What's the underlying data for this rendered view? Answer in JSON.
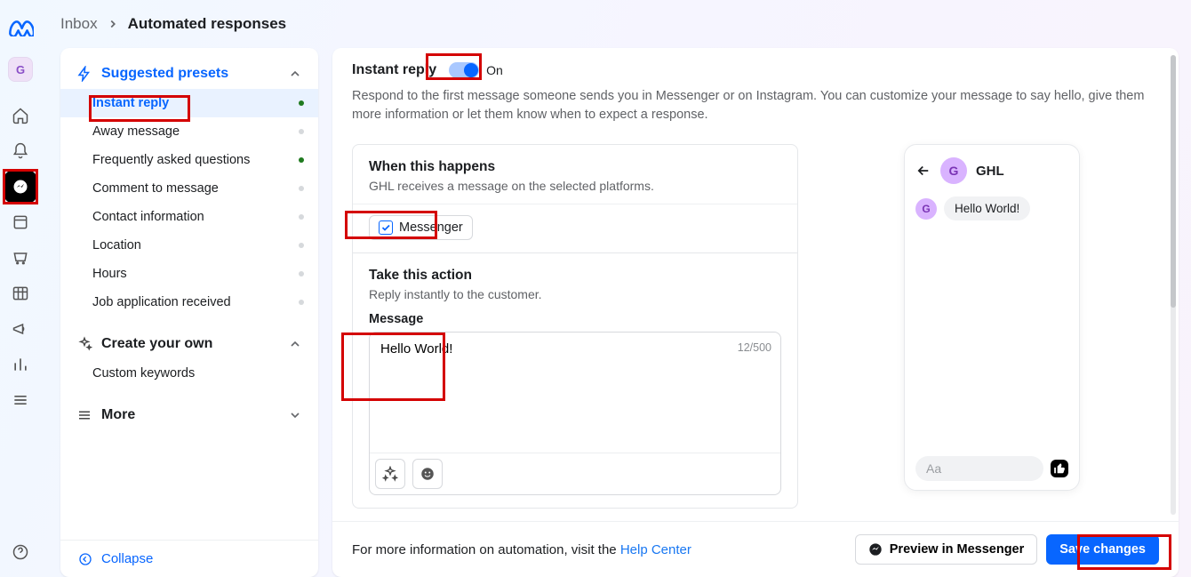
{
  "rail": {
    "avatar_initial": "G"
  },
  "breadcrumb": {
    "root": "Inbox",
    "current": "Automated responses"
  },
  "sidebar": {
    "suggested_label": "Suggested presets",
    "presets": [
      {
        "label": "Instant reply",
        "status": "green",
        "selected": true
      },
      {
        "label": "Away message",
        "status": "gray"
      },
      {
        "label": "Frequently asked questions",
        "status": "green"
      },
      {
        "label": "Comment to message",
        "status": "gray"
      },
      {
        "label": "Contact information",
        "status": "gray"
      },
      {
        "label": "Location",
        "status": "gray"
      },
      {
        "label": "Hours",
        "status": "gray"
      },
      {
        "label": "Job application received",
        "status": "gray"
      }
    ],
    "create_label": "Create your own",
    "create_items": [
      {
        "label": "Custom keywords"
      }
    ],
    "more_label": "More",
    "collapse_label": "Collapse"
  },
  "content": {
    "title": "Instant reply",
    "toggle_state": "On",
    "description": "Respond to the first message someone sends you in Messenger or on Instagram. You can customize your message to say hello, give them more information or let them know when to expect a response.",
    "when": {
      "heading": "When this happens",
      "sub": "GHL receives a message on the selected platforms.",
      "platform_label": "Messenger"
    },
    "action": {
      "heading": "Take this action",
      "sub": "Reply instantly to the customer.",
      "message_label": "Message",
      "message_value": "Hello World!",
      "counter": "12/500"
    },
    "preview": {
      "name": "GHL",
      "avatar_initial": "G",
      "bubble": "Hello World!",
      "input_placeholder": "Aa"
    },
    "footer": {
      "info_text": "For more information on automation, visit the ",
      "link_label": "Help Center",
      "preview_btn": "Preview in Messenger",
      "save_btn": "Save changes"
    }
  }
}
